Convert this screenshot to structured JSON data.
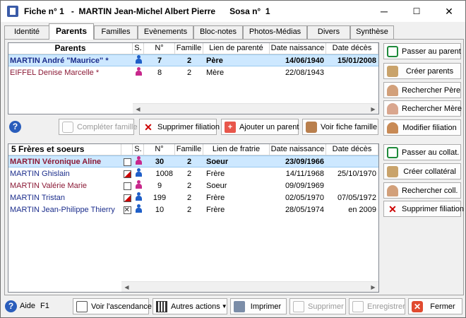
{
  "window": {
    "title": "Fiche n° 1   -  MARTIN Jean-Michel Albert Pierre      Sosa n°  1",
    "minimize": "─",
    "maximize": "☐",
    "close": "✕"
  },
  "tabs": [
    "Identité",
    "Parents",
    "Familles",
    "Evènements",
    "Bloc-notes",
    "Photos-Médias",
    "Divers",
    "Synthèse"
  ],
  "active_tab": "Parents",
  "parents": {
    "headers": [
      "Parents",
      "S.",
      "N°",
      "Famille",
      "Lien de parenté",
      "Date naissance",
      "Date décès"
    ],
    "rows": [
      {
        "name": "MARTIN André \"Maurice\" *",
        "sex": "male",
        "num": "7",
        "famille": "2",
        "lien": "Père",
        "naissance": "14/06/1940",
        "deces": "15/01/2008",
        "color": "#1c2e8c"
      },
      {
        "name": "EIFFEL Denise Marcelle *",
        "sex": "female",
        "num": "8",
        "famille": "2",
        "lien": "Mère",
        "naissance": "22/08/1943",
        "deces": "",
        "color": "#8b1a36"
      }
    ]
  },
  "middle_buttons": {
    "completer": "Compléter famille",
    "supprimer": "Supprimer filiation",
    "ajouter": "Ajouter un parent",
    "voir": "Voir fiche famille"
  },
  "right_parent_buttons": [
    "Passer au parent",
    "Créer parents",
    "Rechercher Père",
    "Rechercher Mère",
    "Modifier filiation"
  ],
  "siblings": {
    "headers": [
      "5  Frères et soeurs",
      "",
      "S.",
      "N°",
      "Famille",
      "Lien de fratrie",
      "Date naissance",
      "Date décès"
    ],
    "rows": [
      {
        "name": "MARTIN Véronique Aline",
        "check": "",
        "sex": "female",
        "num": "30",
        "famille": "2",
        "lien": "Soeur",
        "naissance": "23/09/1966",
        "deces": "",
        "color": "#8b1a36"
      },
      {
        "name": "MARTIN Ghislain",
        "check": "red",
        "sex": "male",
        "num": "1008",
        "famille": "2",
        "lien": "Frère",
        "naissance": "14/11/1968",
        "deces": "25/10/1970",
        "color": "#1c2e8c"
      },
      {
        "name": "MARTIN Valérie Marie",
        "check": "",
        "sex": "female",
        "num": "9",
        "famille": "2",
        "lien": "Soeur",
        "naissance": "09/09/1969",
        "deces": "",
        "color": "#8b1a36"
      },
      {
        "name": "MARTIN Tristan",
        "check": "red",
        "sex": "male",
        "num": "199",
        "famille": "2",
        "lien": "Frère",
        "naissance": "02/05/1970",
        "deces": "07/05/1972",
        "color": "#1c2e8c"
      },
      {
        "name": "MARTIN Jean-Philippe Thierry",
        "check": "x",
        "sex": "male",
        "num": "10",
        "famille": "2",
        "lien": "Frère",
        "naissance": "28/05/1974",
        "deces": "en 2009",
        "color": "#1c2e8c"
      }
    ]
  },
  "right_sibling_buttons": [
    "Passer au collat.",
    "Créer collatéral",
    "Rechercher coll.",
    "Supprimer filiation"
  ],
  "bottom": {
    "aide": "Aide",
    "f1": "F1",
    "ascendance": "Voir l'ascendance",
    "autres": "Autres actions",
    "imprimer": "Imprimer",
    "supprimer": "Supprimer",
    "enregistrer": "Enregistrer",
    "fermer": "Fermer"
  },
  "help_glyph": "?"
}
